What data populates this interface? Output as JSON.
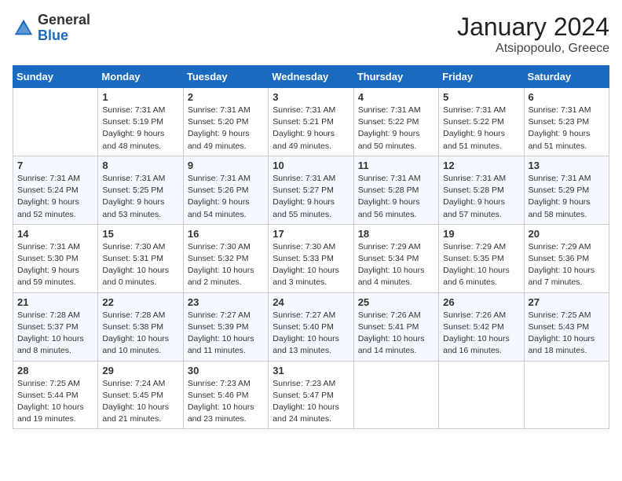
{
  "header": {
    "logo_general": "General",
    "logo_blue": "Blue",
    "title": "January 2024",
    "subtitle": "Atsipopoulo, Greece"
  },
  "weekdays": [
    "Sunday",
    "Monday",
    "Tuesday",
    "Wednesday",
    "Thursday",
    "Friday",
    "Saturday"
  ],
  "weeks": [
    [
      {
        "day": "",
        "info": ""
      },
      {
        "day": "1",
        "info": "Sunrise: 7:31 AM\nSunset: 5:19 PM\nDaylight: 9 hours\nand 48 minutes."
      },
      {
        "day": "2",
        "info": "Sunrise: 7:31 AM\nSunset: 5:20 PM\nDaylight: 9 hours\nand 49 minutes."
      },
      {
        "day": "3",
        "info": "Sunrise: 7:31 AM\nSunset: 5:21 PM\nDaylight: 9 hours\nand 49 minutes."
      },
      {
        "day": "4",
        "info": "Sunrise: 7:31 AM\nSunset: 5:22 PM\nDaylight: 9 hours\nand 50 minutes."
      },
      {
        "day": "5",
        "info": "Sunrise: 7:31 AM\nSunset: 5:22 PM\nDaylight: 9 hours\nand 51 minutes."
      },
      {
        "day": "6",
        "info": "Sunrise: 7:31 AM\nSunset: 5:23 PM\nDaylight: 9 hours\nand 51 minutes."
      }
    ],
    [
      {
        "day": "7",
        "info": "Sunrise: 7:31 AM\nSunset: 5:24 PM\nDaylight: 9 hours\nand 52 minutes."
      },
      {
        "day": "8",
        "info": "Sunrise: 7:31 AM\nSunset: 5:25 PM\nDaylight: 9 hours\nand 53 minutes."
      },
      {
        "day": "9",
        "info": "Sunrise: 7:31 AM\nSunset: 5:26 PM\nDaylight: 9 hours\nand 54 minutes."
      },
      {
        "day": "10",
        "info": "Sunrise: 7:31 AM\nSunset: 5:27 PM\nDaylight: 9 hours\nand 55 minutes."
      },
      {
        "day": "11",
        "info": "Sunrise: 7:31 AM\nSunset: 5:28 PM\nDaylight: 9 hours\nand 56 minutes."
      },
      {
        "day": "12",
        "info": "Sunrise: 7:31 AM\nSunset: 5:28 PM\nDaylight: 9 hours\nand 57 minutes."
      },
      {
        "day": "13",
        "info": "Sunrise: 7:31 AM\nSunset: 5:29 PM\nDaylight: 9 hours\nand 58 minutes."
      }
    ],
    [
      {
        "day": "14",
        "info": "Sunrise: 7:31 AM\nSunset: 5:30 PM\nDaylight: 9 hours\nand 59 minutes."
      },
      {
        "day": "15",
        "info": "Sunrise: 7:30 AM\nSunset: 5:31 PM\nDaylight: 10 hours\nand 0 minutes."
      },
      {
        "day": "16",
        "info": "Sunrise: 7:30 AM\nSunset: 5:32 PM\nDaylight: 10 hours\nand 2 minutes."
      },
      {
        "day": "17",
        "info": "Sunrise: 7:30 AM\nSunset: 5:33 PM\nDaylight: 10 hours\nand 3 minutes."
      },
      {
        "day": "18",
        "info": "Sunrise: 7:29 AM\nSunset: 5:34 PM\nDaylight: 10 hours\nand 4 minutes."
      },
      {
        "day": "19",
        "info": "Sunrise: 7:29 AM\nSunset: 5:35 PM\nDaylight: 10 hours\nand 6 minutes."
      },
      {
        "day": "20",
        "info": "Sunrise: 7:29 AM\nSunset: 5:36 PM\nDaylight: 10 hours\nand 7 minutes."
      }
    ],
    [
      {
        "day": "21",
        "info": "Sunrise: 7:28 AM\nSunset: 5:37 PM\nDaylight: 10 hours\nand 8 minutes."
      },
      {
        "day": "22",
        "info": "Sunrise: 7:28 AM\nSunset: 5:38 PM\nDaylight: 10 hours\nand 10 minutes."
      },
      {
        "day": "23",
        "info": "Sunrise: 7:27 AM\nSunset: 5:39 PM\nDaylight: 10 hours\nand 11 minutes."
      },
      {
        "day": "24",
        "info": "Sunrise: 7:27 AM\nSunset: 5:40 PM\nDaylight: 10 hours\nand 13 minutes."
      },
      {
        "day": "25",
        "info": "Sunrise: 7:26 AM\nSunset: 5:41 PM\nDaylight: 10 hours\nand 14 minutes."
      },
      {
        "day": "26",
        "info": "Sunrise: 7:26 AM\nSunset: 5:42 PM\nDaylight: 10 hours\nand 16 minutes."
      },
      {
        "day": "27",
        "info": "Sunrise: 7:25 AM\nSunset: 5:43 PM\nDaylight: 10 hours\nand 18 minutes."
      }
    ],
    [
      {
        "day": "28",
        "info": "Sunrise: 7:25 AM\nSunset: 5:44 PM\nDaylight: 10 hours\nand 19 minutes."
      },
      {
        "day": "29",
        "info": "Sunrise: 7:24 AM\nSunset: 5:45 PM\nDaylight: 10 hours\nand 21 minutes."
      },
      {
        "day": "30",
        "info": "Sunrise: 7:23 AM\nSunset: 5:46 PM\nDaylight: 10 hours\nand 23 minutes."
      },
      {
        "day": "31",
        "info": "Sunrise: 7:23 AM\nSunset: 5:47 PM\nDaylight: 10 hours\nand 24 minutes."
      },
      {
        "day": "",
        "info": ""
      },
      {
        "day": "",
        "info": ""
      },
      {
        "day": "",
        "info": ""
      }
    ]
  ]
}
